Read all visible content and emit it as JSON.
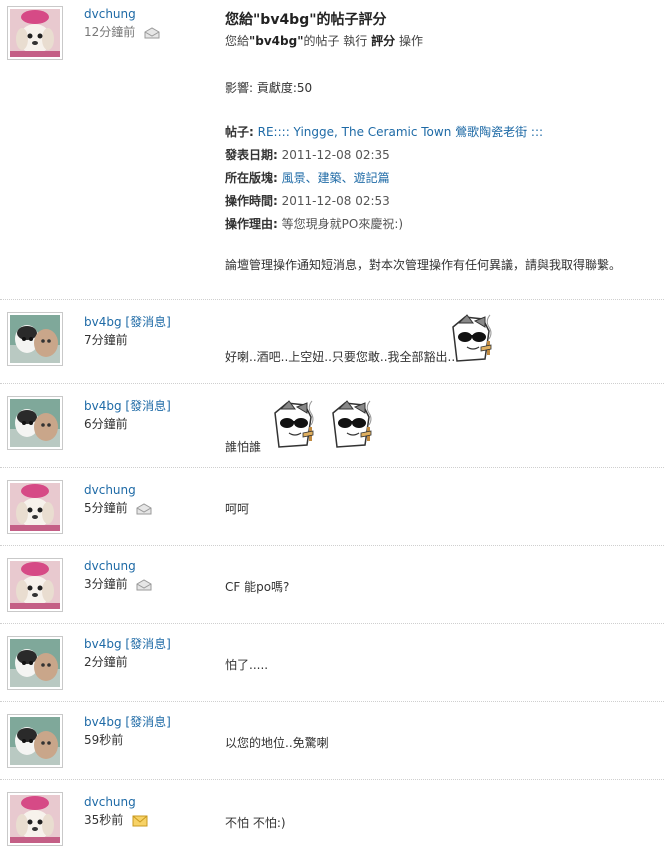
{
  "messages": [
    {
      "user": "dvchung",
      "time": "12分鐘前",
      "avatar": "dog-avatar",
      "envelope": "read",
      "system": {
        "title": "您給\"bv4bg\"的帖子評分",
        "sub_prefix": "您給",
        "sub_user": "\"bv4bg\"",
        "sub_mid": "的帖子 執行 ",
        "sub_action": "評分",
        "sub_suffix": " 操作",
        "influence": "影響: 貢獻度:50",
        "post_label": "帖子:",
        "post_value": "RE:::: Yingge, The Ceramic Town 鶯歌陶瓷老街 :::",
        "date_label": "發表日期:",
        "date_value": "2011-12-08 02:35",
        "forum_label": "所在版塊:",
        "forum_value": "風景、建築、遊記篇",
        "optime_label": "操作時間:",
        "optime_value": "2011-12-08 02:53",
        "reason_label": "操作理由:",
        "reason_value": "等您現身就PO來慶祝:)",
        "footer": "論壇管理操作通知短消息，對本次管理操作有任何異議，請與我取得聯繫。"
      }
    },
    {
      "user": "bv4bg",
      "sendmsg": "[發消息]",
      "time": "7分鐘前",
      "avatar": "cat-avatar",
      "text": "好喇..酒吧..上空妞..只要您敢..我全部豁出..",
      "emotes": 1
    },
    {
      "user": "bv4bg",
      "sendmsg": "[發消息]",
      "time": "6分鐘前",
      "avatar": "cat-avatar",
      "text": "誰怕誰",
      "emotes": 2
    },
    {
      "user": "dvchung",
      "time": "5分鐘前",
      "avatar": "dog-avatar",
      "envelope": "read",
      "text": "呵呵"
    },
    {
      "user": "dvchung",
      "time": "3分鐘前",
      "avatar": "dog-avatar",
      "envelope": "read",
      "text": "CF 能po嗎?"
    },
    {
      "user": "bv4bg",
      "sendmsg": "[發消息]",
      "time": "2分鐘前",
      "avatar": "cat-avatar",
      "text": "怕了....."
    },
    {
      "user": "bv4bg",
      "sendmsg": "[發消息]",
      "time": "59秒前",
      "avatar": "cat-avatar",
      "text": "以您的地位..免驚喇"
    },
    {
      "user": "dvchung",
      "time": "35秒前",
      "avatar": "dog-avatar",
      "envelope": "unread",
      "text": "不怕 不怕:)"
    }
  ],
  "colors": {
    "link": "#1e6aa6",
    "divider": "#cfcfcf",
    "envelope_unread": "#f2c84b",
    "envelope_read": "#d9d9d9"
  }
}
